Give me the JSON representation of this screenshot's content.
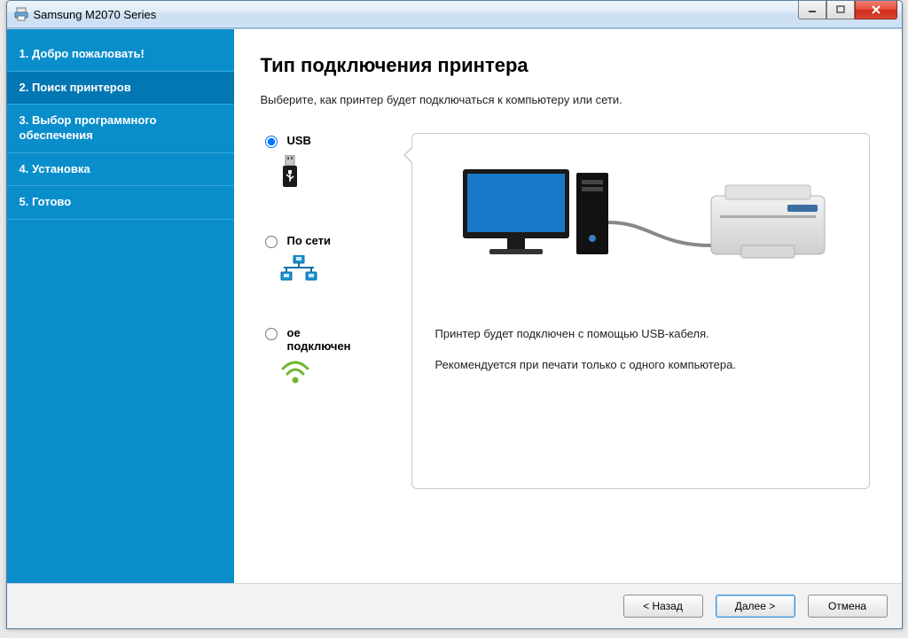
{
  "window": {
    "title": "Samsung M2070 Series"
  },
  "sidebar": {
    "items": [
      {
        "label": "1. Добро пожаловать!"
      },
      {
        "label": "2. Поиск принтеров"
      },
      {
        "label": "3. Выбор программного обеспечения"
      },
      {
        "label": "4. Установка"
      },
      {
        "label": "5. Готово"
      }
    ],
    "active_index": 1
  },
  "page": {
    "heading": "Тип подключения принтера",
    "subtitle": "Выберите, как принтер будет подключаться к компьютеру или сети."
  },
  "options": {
    "usb": {
      "label": "USB",
      "selected": true
    },
    "network": {
      "label": "По сети",
      "selected": false
    },
    "wireless": {
      "label_line1": "ое",
      "label_line2": "подключен",
      "selected": false
    }
  },
  "description": {
    "line1": "Принтер будет подключен с помощью USB-кабеля.",
    "line2": "Рекомендуется при печати только с одного компьютера."
  },
  "buttons": {
    "back": "< Назад",
    "next": "Далее >",
    "cancel": "Отмена"
  }
}
